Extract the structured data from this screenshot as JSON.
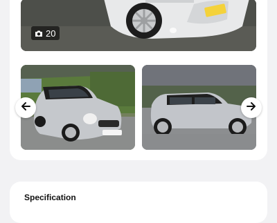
{
  "gallery": {
    "photo_count": "20",
    "icons": {
      "camera": "camera-icon",
      "prev": "arrow-left-icon",
      "next": "arrow-right-icon"
    },
    "colors": {
      "badge_bg": "#1a1a1a",
      "card_bg": "#ffffff",
      "page_bg": "#f2f2f4"
    }
  },
  "specification": {
    "title": "Specification"
  }
}
